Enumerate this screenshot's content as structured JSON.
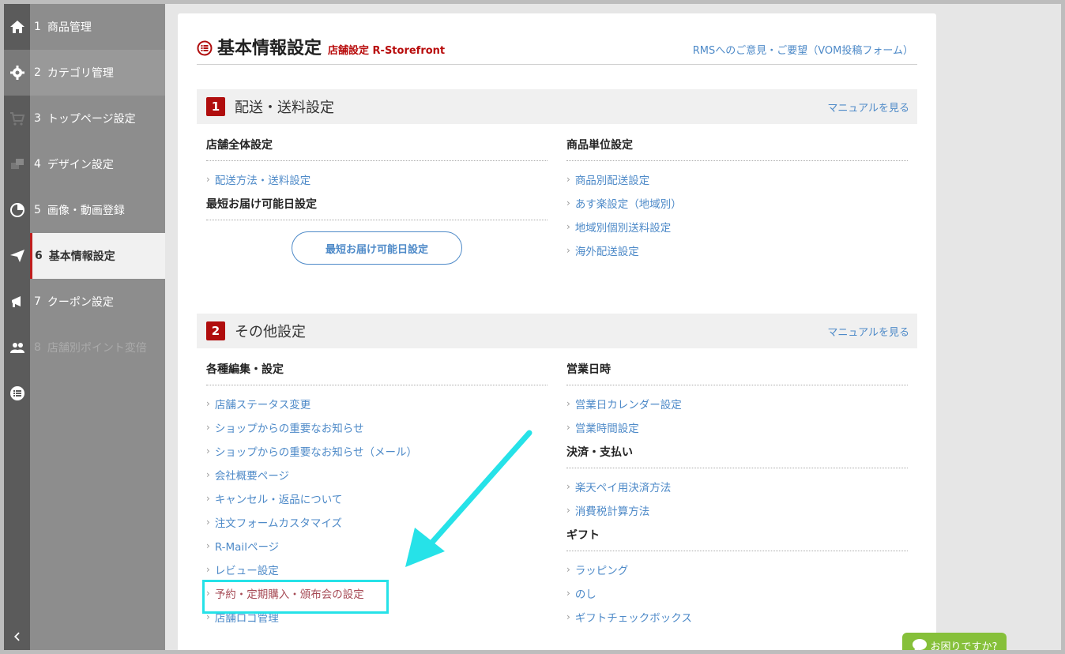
{
  "sidebar": {
    "items": [
      {
        "num": "1",
        "label": "商品管理"
      },
      {
        "num": "2",
        "label": "カテゴリ管理"
      },
      {
        "num": "3",
        "label": "トップページ設定"
      },
      {
        "num": "4",
        "label": "デザイン設定"
      },
      {
        "num": "5",
        "label": "画像・動画登録"
      },
      {
        "num": "6",
        "label": "基本情報設定"
      },
      {
        "num": "7",
        "label": "クーポン設定"
      },
      {
        "num": "8",
        "label": "店舗別ポイント変倍"
      }
    ],
    "icons": [
      "home-icon",
      "gear-icon",
      "cart-icon",
      "design-icon",
      "pie-chart-icon",
      "paper-plane-icon",
      "megaphone-icon",
      "users-icon",
      "list-icon",
      "chevron-left-icon"
    ]
  },
  "header": {
    "title": "基本情報設定",
    "subtitle": "店舗設定 R-Storefront",
    "feedback_link": "RMSへのご意見・ご要望（VOM投稿フォーム）"
  },
  "sections": [
    {
      "number": "1",
      "title": "配送・送料設定",
      "manual_link": "マニュアルを見る",
      "left": {
        "groups": [
          {
            "heading": "店舗全体設定",
            "links": [
              "配送方法・送料設定"
            ]
          },
          {
            "heading": "最短お届け可能日設定",
            "button": "最短お届け可能日設定"
          }
        ]
      },
      "right": {
        "groups": [
          {
            "heading": "商品単位設定",
            "links": [
              "商品別配送設定",
              "あす楽設定（地域別）",
              "地域別個別送料設定",
              "海外配送設定"
            ]
          }
        ]
      }
    },
    {
      "number": "2",
      "title": "その他設定",
      "manual_link": "マニュアルを見る",
      "left": {
        "groups": [
          {
            "heading": "各種編集・設定",
            "links": [
              "店舗ステータス変更",
              "ショップからの重要なお知らせ",
              "ショップからの重要なお知らせ（メール）",
              "会社概要ページ",
              "キャンセル・返品について",
              "注文フォームカスタマイズ",
              "R-Mailページ",
              "レビュー設定",
              "予約・定期購入・頒布会の設定",
              "店舗ロゴ管理"
            ]
          }
        ]
      },
      "right": {
        "groups": [
          {
            "heading": "営業日時",
            "links": [
              "営業日カレンダー設定",
              "営業時間設定"
            ]
          },
          {
            "heading": "決済・支払い",
            "links": [
              "楽天ペイ用決済方法",
              "消費税計算方法"
            ]
          },
          {
            "heading": "ギフト",
            "links": [
              "ラッピング",
              "のし",
              "ギフトチェックボックス"
            ]
          }
        ]
      }
    }
  ],
  "help_button": "お困りですか?",
  "colors": {
    "accent_red": "#b00d0d",
    "link_blue": "#4e8ac8",
    "highlight_cyan": "#26e2e8",
    "help_green": "#86c03a"
  }
}
